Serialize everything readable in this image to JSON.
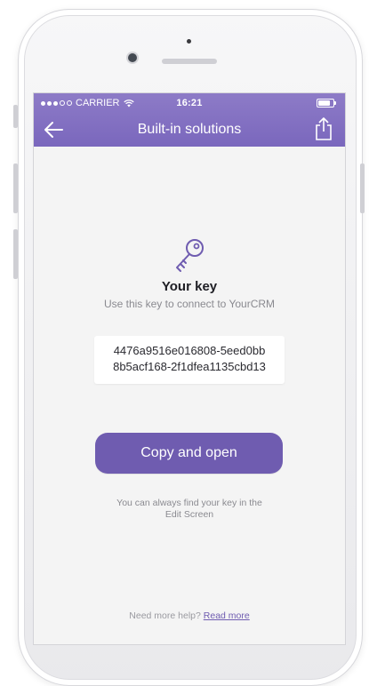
{
  "status_bar": {
    "carrier": "CARRIER",
    "time": "16:21"
  },
  "nav": {
    "title": "Built-in solutions",
    "back_icon": "arrow-left-icon",
    "share_icon": "share-icon"
  },
  "key_section": {
    "icon": "key-icon",
    "heading": "Your key",
    "description": "Use this key to connect to YourCRM",
    "key_line1": "4476a9516e016808-5eed0bb",
    "key_line2": "8b5acf168-2f1dfea1135cbd13"
  },
  "primary_button": {
    "label": "Copy and open"
  },
  "hint": {
    "line1": "You can always find your key in the",
    "line2": "Edit Screen"
  },
  "footer": {
    "prefix": "Need more help?",
    "link": "Read more"
  },
  "colors": {
    "accent": "#7a67bd",
    "button": "#6f5cb0",
    "background": "#f4f4f4"
  }
}
